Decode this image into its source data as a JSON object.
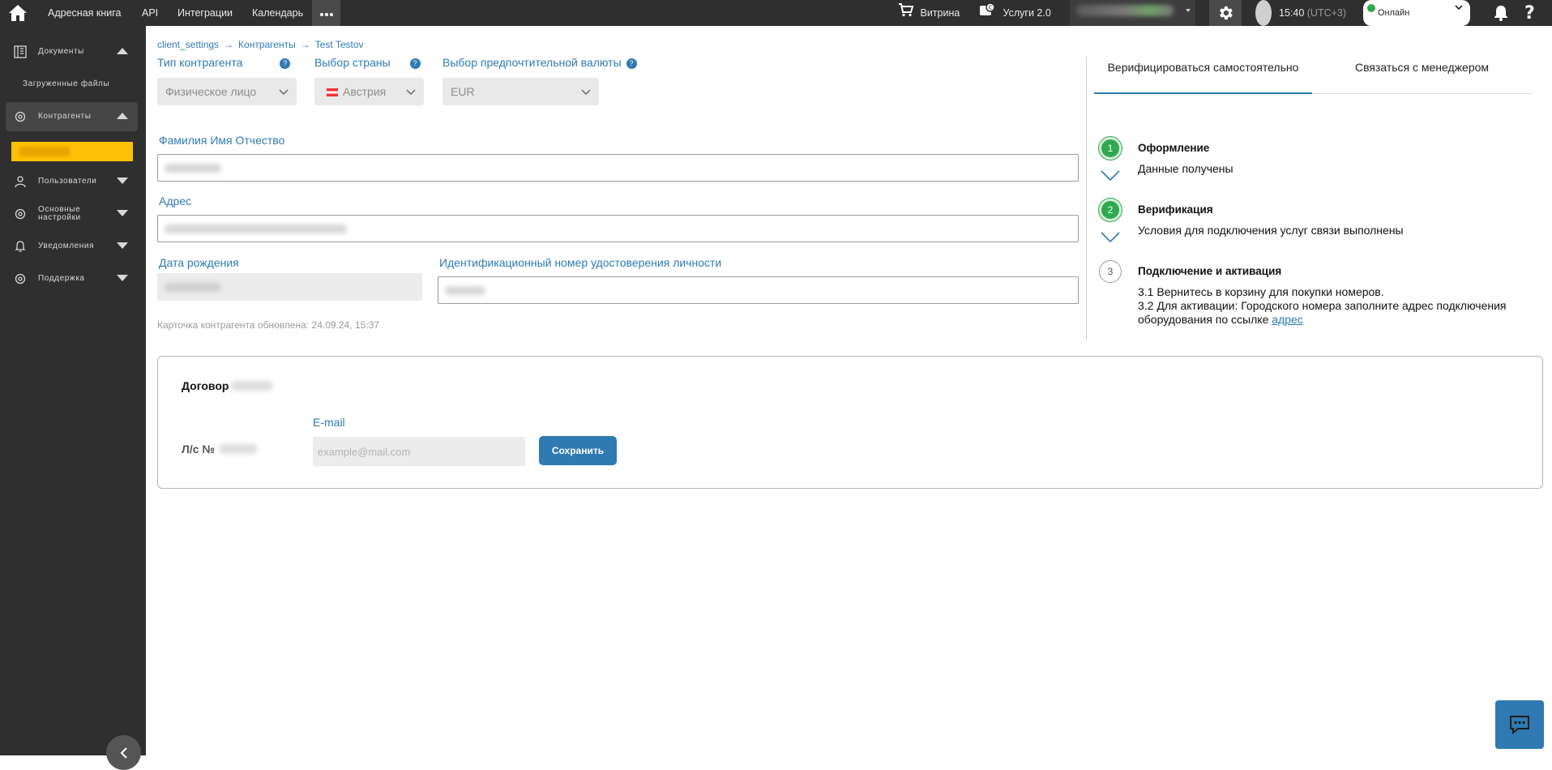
{
  "topbar": {
    "nav": [
      "Адресная книга",
      "API",
      "Интеграции",
      "Календарь"
    ],
    "showcase": "Витрина",
    "services": "Услуги 2.0",
    "time": "15:40",
    "timezone": "(UTC+3)",
    "status": "Онлайн"
  },
  "sidebar": {
    "documents": "Документы",
    "uploaded_files": "Загруженные файлы",
    "counterparties": "Контрагенты",
    "users": "Пользователи",
    "main_settings_1": "Основные",
    "main_settings_2": "настройки",
    "notifications": "Уведомления",
    "support": "Поддержка"
  },
  "breadcrumb": [
    "client_settings",
    "Контрагенты",
    "Test Testov"
  ],
  "form": {
    "type_label": "Тип контрагента",
    "type_value": "Физическое лицо",
    "country_label": "Выбор страны",
    "country_value": "Австрия",
    "currency_label": "Выбор предпочтительной валюты",
    "currency_value": "EUR",
    "help_mark": "?",
    "fio_label": "Фамилия Имя Отчество",
    "address_label": "Адрес",
    "birth_label": "Дата рождения",
    "id_label": "Идентификационный номер удостоверения личности",
    "updated": "Карточка контрагента обновлена: 24.09.24, 15:37"
  },
  "verification": {
    "tabs": [
      "Верифицироваться самостоятельно",
      "Связаться с менеджером"
    ],
    "steps": [
      {
        "num": "1",
        "title": "Оформление",
        "lines": [
          "Данные получены"
        ],
        "done": true
      },
      {
        "num": "2",
        "title": "Верификация",
        "lines": [
          "Условия для подключения услуг связи выполнены"
        ],
        "done": true
      },
      {
        "num": "3",
        "title": "Подключение и активация",
        "lines": [
          "3.1 Вернитесь в корзину для покупки номеров.",
          "3.2 Для активации: Городского номера заполните адрес подключения",
          "оборудования по ссылке"
        ],
        "link": "адрес",
        "done": false
      }
    ]
  },
  "contract": {
    "title": "Договор",
    "account": "Л/с №",
    "email_label": "E-mail",
    "email_placeholder": "example@mail.com",
    "save": "Сохранить"
  },
  "colors": {
    "accent": "#2f7ab3",
    "success": "#2fa84f",
    "highlight": "#ffc107",
    "bar": "#2f2f2f"
  }
}
